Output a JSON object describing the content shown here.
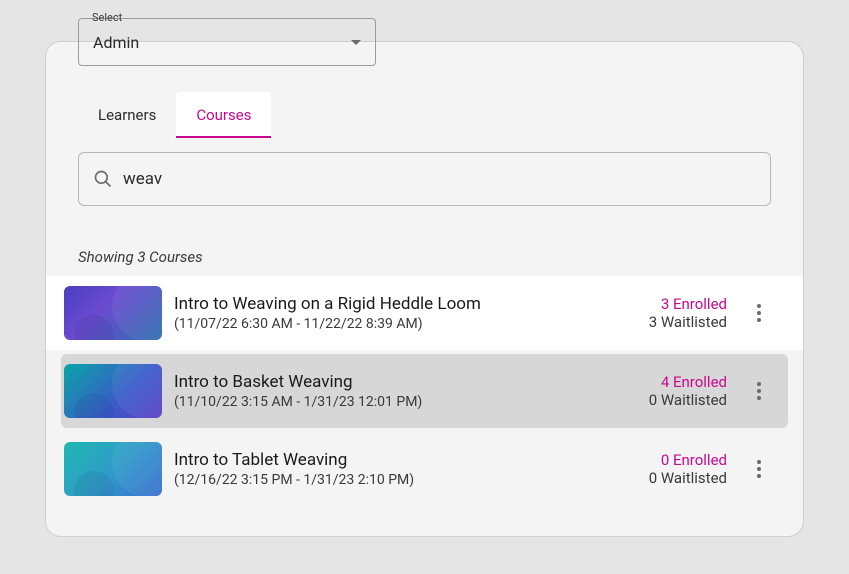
{
  "select": {
    "label": "Select",
    "value": "Admin"
  },
  "tabs": {
    "learners": "Learners",
    "courses": "Courses"
  },
  "search": {
    "value": "weav"
  },
  "summary": "Showing 3 Courses",
  "rows": [
    {
      "title": "Intro to Weaving on a Rigid Heddle Loom",
      "dates": "(11/07/22 6:30 AM - 11/22/22 8:39 AM)",
      "enrolled": "3 Enrolled",
      "waitlisted": "3 Waitlisted"
    },
    {
      "title": "Intro to Basket Weaving",
      "dates": "(11/10/22 3:15 AM - 1/31/23 12:01 PM)",
      "enrolled": "4 Enrolled",
      "waitlisted": "0 Waitlisted"
    },
    {
      "title": "Intro to Tablet Weaving",
      "dates": "(12/16/22 3:15 PM - 1/31/23 2:10 PM)",
      "enrolled": "0 Enrolled",
      "waitlisted": "0 Waitlisted"
    }
  ]
}
